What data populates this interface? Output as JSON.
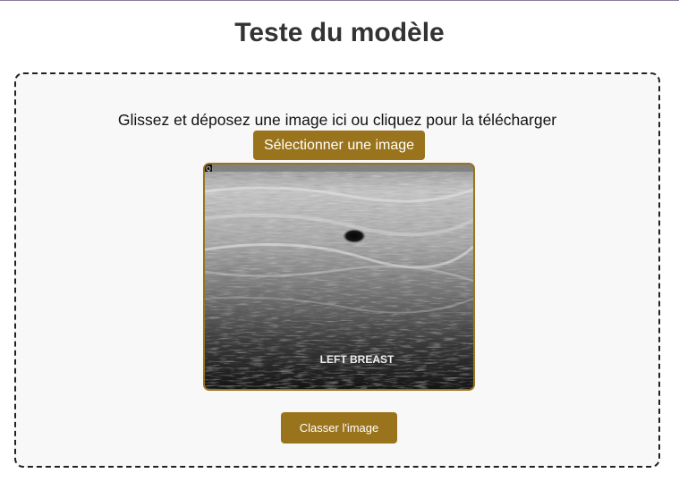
{
  "header": {
    "title": "Teste du modèle"
  },
  "upload": {
    "instructions": "Glissez et déposez une image ici ou cliquez pour la télécharger",
    "select_label": "Sélectionner une image",
    "preview_caption": "LEFT BREAST",
    "corner_marker": "Q"
  },
  "actions": {
    "classify_label": "Classer l'image"
  },
  "colors": {
    "accent": "#9a741c",
    "title": "#333333",
    "dropzone_bg": "#f8f8f8",
    "dropzone_border": "#222222"
  }
}
